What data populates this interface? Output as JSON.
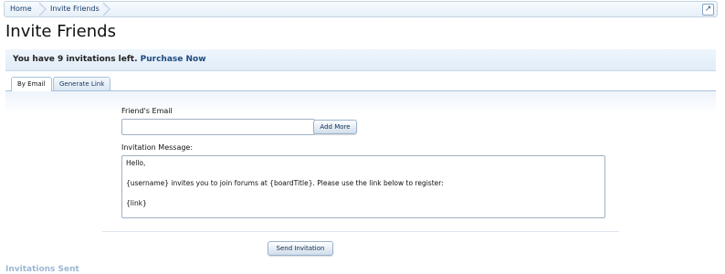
{
  "breadcrumb": {
    "home": "Home",
    "current": "Invite Friends"
  },
  "page": {
    "title": "Invite Friends"
  },
  "notice": {
    "text": "You have 9 invitations left.",
    "link": "Purchase Now"
  },
  "tabs": [
    {
      "label": "By Email"
    },
    {
      "label": "Generate Link"
    }
  ],
  "form": {
    "email_label": "Friend's Email",
    "email_value": "",
    "add_more_label": "Add More",
    "message_label": "Invitation Message:",
    "message_lines": [
      "Hello,",
      "{username} invites you to join forums at {boardTitle}. Please use the link below to register:",
      "{link}"
    ],
    "send_label": "Send Invitation"
  },
  "section": {
    "invitations_sent": "Invitations Sent"
  },
  "colors": {
    "link": "#1d4b7f",
    "section_heading": "#9cb7d3",
    "tab_border": "#a9c1da"
  }
}
